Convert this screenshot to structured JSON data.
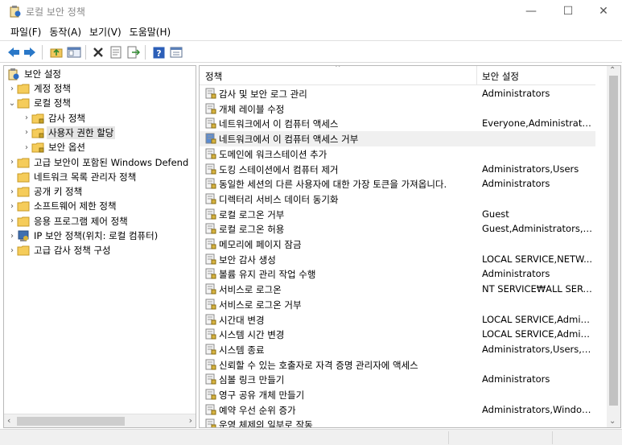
{
  "window": {
    "title": "로컬 보안 정책",
    "minimize_glyph": "—",
    "maximize_glyph": "☐",
    "close_glyph": "✕"
  },
  "menubar": {
    "items": [
      "파일(F)",
      "동작(A)",
      "보기(V)",
      "도움말(H)"
    ]
  },
  "toolbar": {
    "buttons": [
      "back-icon",
      "forward-icon",
      "up-folder-icon",
      "show-tree-icon",
      "delete-icon",
      "properties-icon",
      "export-icon",
      "help-icon",
      "view-icon"
    ]
  },
  "tree": {
    "root": "보안 설정",
    "items": [
      {
        "label": "계정 정책",
        "expander": "›",
        "level": 1
      },
      {
        "label": "로컬 정책",
        "expander": "⌄",
        "level": 1
      },
      {
        "label": "감사 정책",
        "expander": "›",
        "level": 2
      },
      {
        "label": "사용자 권한 할당",
        "expander": "›",
        "level": 2,
        "selected": true
      },
      {
        "label": "보안 옵션",
        "expander": "›",
        "level": 2
      },
      {
        "label": "고급 보안이 포함된 Windows Defend",
        "expander": "›",
        "level": 1
      },
      {
        "label": "네트워크 목록 관리자 정책",
        "expander": "",
        "level": 1
      },
      {
        "label": "공개 키 정책",
        "expander": "›",
        "level": 1
      },
      {
        "label": "소프트웨어 제한 정책",
        "expander": "›",
        "level": 1
      },
      {
        "label": "응용 프로그램 제어 정책",
        "expander": "›",
        "level": 1
      },
      {
        "label": "IP 보안 정책(위치: 로컬 컴퓨터)",
        "expander": "›",
        "level": 1
      },
      {
        "label": "고급 감사 정책 구성",
        "expander": "›",
        "level": 1
      }
    ]
  },
  "list": {
    "columns": [
      "정책",
      "보안 설정"
    ],
    "sort_indicator": "^",
    "rows": [
      {
        "policy": "감사 및 보안 로그 관리",
        "setting": "Administrators"
      },
      {
        "policy": "개체 레이블 수정",
        "setting": ""
      },
      {
        "policy": "네트워크에서 이 컴퓨터 액세스",
        "setting": "Everyone,Administrators..."
      },
      {
        "policy": "네트워크에서 이 컴퓨터 액세스 거부",
        "setting": "",
        "selected": true
      },
      {
        "policy": "도메인에 워크스테이션 추가",
        "setting": ""
      },
      {
        "policy": "도킹 스테이션에서 컴퓨터 제거",
        "setting": "Administrators,Users"
      },
      {
        "policy": "동일한 세션의 다른 사용자에 대한 가장 토큰을 가져옵니다.",
        "setting": "Administrators"
      },
      {
        "policy": "디렉터리 서비스 데이터 동기화",
        "setting": ""
      },
      {
        "policy": "로컬 로그온 거부",
        "setting": "Guest"
      },
      {
        "policy": "로컬 로그온 허용",
        "setting": "Guest,Administrators,Us..."
      },
      {
        "policy": "메모리에 페이지 잠금",
        "setting": ""
      },
      {
        "policy": "보안 감사 생성",
        "setting": "LOCAL SERVICE,NETW..."
      },
      {
        "policy": "볼륨 유지 관리 작업 수행",
        "setting": "Administrators"
      },
      {
        "policy": "서비스로 로그온",
        "setting": "NT SERVICE₩ALL SERVI..."
      },
      {
        "policy": "서비스로 로그온 거부",
        "setting": ""
      },
      {
        "policy": "시간대 변경",
        "setting": "LOCAL SERVICE,Admini..."
      },
      {
        "policy": "시스템 시간 변경",
        "setting": "LOCAL SERVICE,Admini..."
      },
      {
        "policy": "시스템 종료",
        "setting": "Administrators,Users,*S-..."
      },
      {
        "policy": "신뢰할 수 있는 호출자로 자격 증명 관리자에 액세스",
        "setting": ""
      },
      {
        "policy": "심볼 링크 만들기",
        "setting": "Administrators"
      },
      {
        "policy": "영구 공유 개체 만들기",
        "setting": ""
      },
      {
        "policy": "예약 우선 순위 증가",
        "setting": "Administrators,Window ..."
      },
      {
        "policy": "운영 체제의 일부로 작동",
        "setting": ""
      }
    ]
  },
  "scroll": {
    "up": "⌃",
    "down": "⌄",
    "left": "‹",
    "right": "›"
  }
}
